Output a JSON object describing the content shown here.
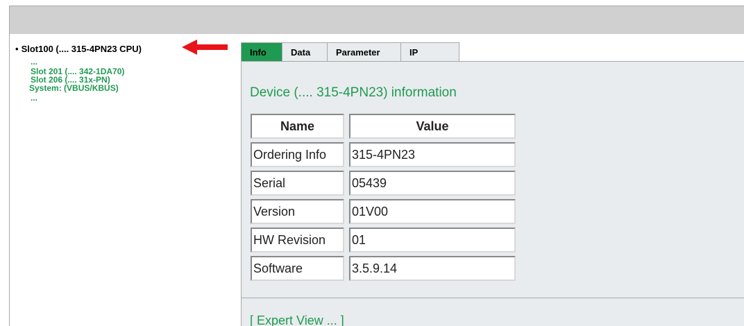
{
  "tree": {
    "root_label": "Slot100 (.... 315-4PN23 CPU)",
    "items": [
      "...",
      "Slot 201 (.... 342-1DA70)",
      "Slot 206 (.... 31x-PN)",
      "System: (VBUS/KBUS)",
      "..."
    ]
  },
  "tabs": [
    "Info",
    "Data",
    "Parameter",
    "IP"
  ],
  "active_tab": "Info",
  "info": {
    "title": "Device (.... 315-4PN23) information",
    "table": {
      "headers": [
        "Name",
        "Value"
      ],
      "rows": [
        [
          "Ordering Info",
          "315-4PN23"
        ],
        [
          "Serial",
          "05439"
        ],
        [
          "Version",
          "01V00"
        ],
        [
          "HW Revision",
          "01"
        ],
        [
          "Software",
          "3.5.9.14"
        ]
      ]
    }
  },
  "footer": {
    "link": "[ Expert View ... ]"
  },
  "colors": {
    "accent": "#1f9a52",
    "arrow": "#e8141a",
    "panel_bg": "#e9ecee",
    "topbar": "#d0d0d0"
  }
}
